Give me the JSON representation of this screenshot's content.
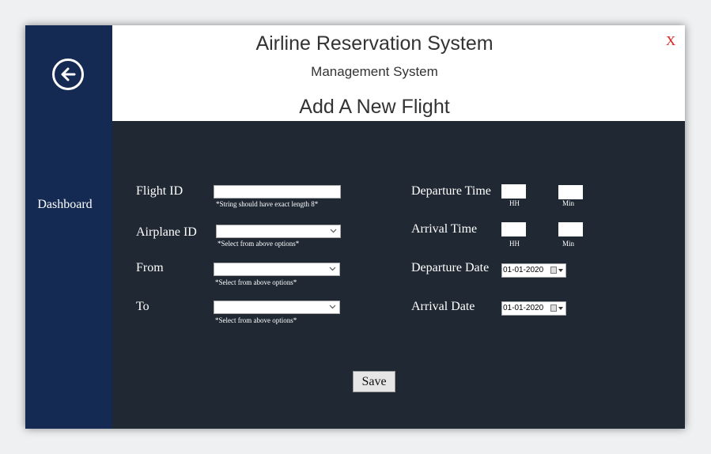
{
  "header": {
    "title": "Airline Reservation System",
    "subtitle": "Management System",
    "form_title": "Add A New Flight",
    "close_label": "X"
  },
  "sidebar": {
    "back_icon": "arrow-left-circle-icon",
    "dashboard_label": "Dashboard"
  },
  "form": {
    "flight_id": {
      "label": "Flight ID",
      "value": "",
      "hint": "*String should have exact length 8*"
    },
    "airplane_id": {
      "label": "Airplane ID",
      "value": "",
      "hint": "*Select from above options*"
    },
    "from": {
      "label": "From",
      "value": "",
      "hint": "*Select from above options*"
    },
    "to": {
      "label": "To",
      "value": "",
      "hint": "*Select from above options*"
    },
    "departure_time": {
      "label": "Departure Time",
      "hh_label": "HH",
      "min_label": "Min"
    },
    "arrival_time": {
      "label": "Arrival Time",
      "hh_label": "HH",
      "min_label": "Min"
    },
    "departure_date": {
      "label": "Departure Date",
      "value": "01-01-2020"
    },
    "arrival_date": {
      "label": "Arrival Date",
      "value": "01-01-2020"
    },
    "save_label": "Save"
  },
  "colors": {
    "sidebar_bg": "#152a52",
    "form_bg": "#1f2833",
    "header_bg": "#ffffff",
    "close_red": "#e0201b"
  }
}
